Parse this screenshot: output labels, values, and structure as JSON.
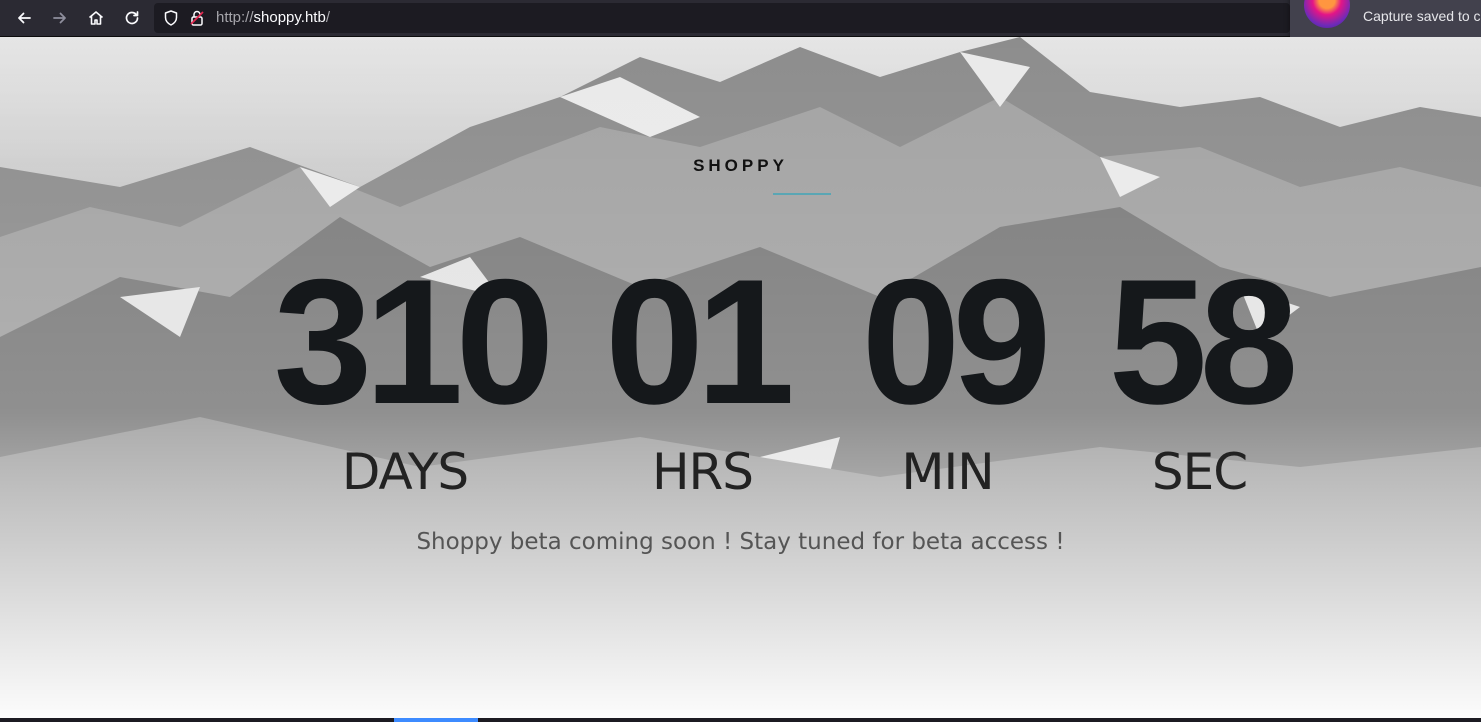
{
  "browser": {
    "url_scheme": "http://",
    "url_host": "shoppy.htb",
    "url_path": "/",
    "notification": "Capture saved to c"
  },
  "page": {
    "brand": "SHOPPY",
    "countdown": [
      {
        "value": "310",
        "label": "DAYS"
      },
      {
        "value": "01",
        "label": "HRS"
      },
      {
        "value": "09",
        "label": "MIN"
      },
      {
        "value": "58",
        "label": "SEC"
      }
    ],
    "tagline": "Shoppy beta coming soon ! Stay tuned for beta access !"
  },
  "icons": [
    "back-icon",
    "forward-icon",
    "home-icon",
    "reload-icon",
    "shield-icon",
    "lock-insecure-icon"
  ],
  "colors": {
    "toolbar_bg": "#2b2a33",
    "urlbar_bg": "#1c1b22",
    "digit_color": "#15181b",
    "brand_underline": "#5aa6b4"
  }
}
